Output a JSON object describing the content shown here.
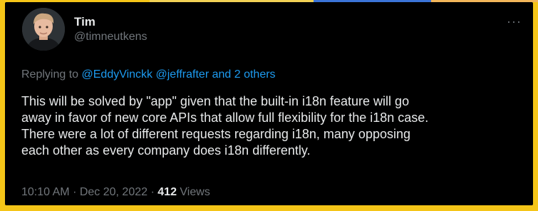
{
  "tweet": {
    "author": {
      "name": "Tim",
      "handle": "@timneutkens"
    },
    "replying": {
      "prefix": "Replying to",
      "mention_1": "@EddyVinckk",
      "mention_2": "@jeffrafter",
      "others": "and 2 others"
    },
    "lines": [
      "This will be solved by \"app\" given that the built-in i18n feature will go",
      "away in favor of new core APIs that allow full flexibility for the i18n case.",
      "There were a lot of different requests regarding i18n, many opposing",
      "each other as every company does i18n differently."
    ],
    "meta": {
      "time": "10:10 AM",
      "separator": "·",
      "date": "Dec 20, 2022",
      "views_count": "412",
      "views_label": "Views"
    },
    "more_icon": "more-horizontal-icon"
  },
  "colors": {
    "page_background": "#f5c518",
    "card_background": "#000000",
    "primary_text": "#e7e9ea",
    "secondary_text": "#71767b",
    "link": "#1d9bf0"
  }
}
